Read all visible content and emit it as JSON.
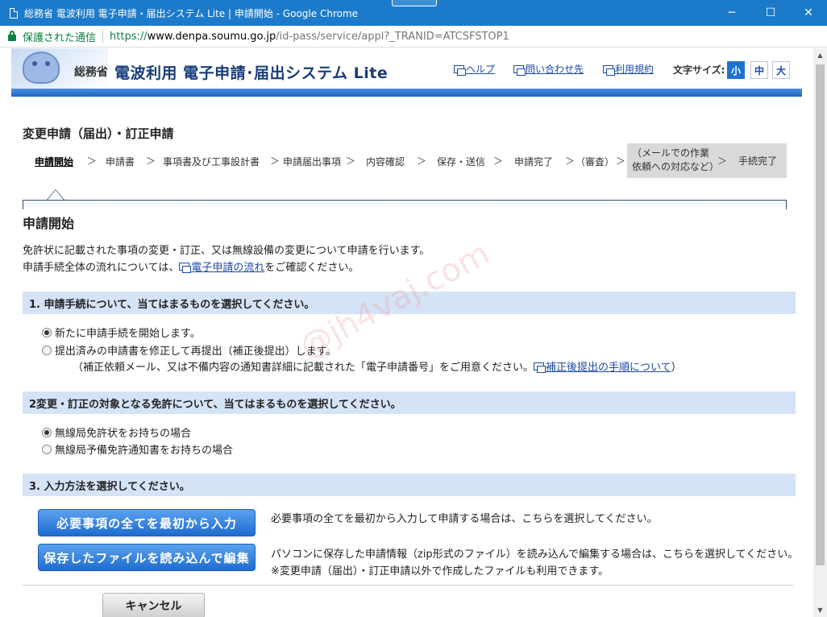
{
  "window": {
    "title": "総務省 電波利用 電子申請・届出システム Lite | 申請開始 - Google Chrome",
    "minimize": "─",
    "maximize": "☐",
    "close": "✕"
  },
  "address": {
    "secure_label": "保護された通信",
    "url_scheme": "https://",
    "url_host": "www.denpa.soumu.go.jp",
    "url_path": "/id-pass/service/appl?_TRANID=ATCSFSTOP1"
  },
  "header": {
    "ministry": "総務省",
    "site_title": "電波利用 電子申請･届出システム Lite",
    "links": [
      "ヘルプ",
      "問い合わせ先",
      "利用規約"
    ],
    "font_size_label": "文字サイズ:",
    "font_sizes": [
      "小",
      "中",
      "大"
    ],
    "active_font_size": "小"
  },
  "page": {
    "heading": "変更申請（届出）・訂正申請",
    "steps": [
      "申請開始",
      "申請書",
      "事項書及び工事設計書",
      "申請届出事項",
      "内容確認",
      "保存・送信",
      "申請完了",
      "（審査）"
    ],
    "step_gray_1": "（メールでの作業依頼への対応など）",
    "step_gray_2": "手続完了",
    "step_arrow": "＞",
    "section_title": "申請開始",
    "intro1": "免許状に記載された事項の変更・訂正、又は無線設備の変更について申請を行います。",
    "intro2_before": "申請手続全体の流れについては、",
    "intro2_link": "電子申請の流れ",
    "intro2_after": "をご確認ください。"
  },
  "q1": {
    "title": "1. 申請手続について、当てはまるものを選択してください。",
    "opt1": "新たに申請手続を開始します。",
    "opt2": "提出済みの申請書を修正して再提出（補正後提出）します。",
    "note_before": "（補正依頼メール、又は不備内容の通知書詳細に記載された「電子申請番号」をご用意ください。",
    "note_link": "補正後提出の手順について",
    "note_after": "）"
  },
  "q2": {
    "title": "2変更・訂正の対象となる免許について、当てはまるものを選択してください。",
    "opt1": "無線局免許状をお持ちの場合",
    "opt2": "無線局予備免許通知書をお持ちの場合"
  },
  "q3": {
    "title": "3. 入力方法を選択してください。",
    "btn1": "必要事項の全てを最初から入力",
    "desc1": "必要事項の全てを最初から入力して申請する場合は、こちらを選択してください。",
    "btn2": "保存したファイルを読み込んで編集",
    "desc2a": "パソコンに保存した申請情報（zip形式のファイル）を読み込んで編集する場合は、こちらを選択してください。",
    "desc2b": "※変更申請（届出）・訂正申請以外で作成したファイルも利用できます。",
    "cancel": "キャンセル"
  },
  "watermark": "@jh4vaj.com"
}
